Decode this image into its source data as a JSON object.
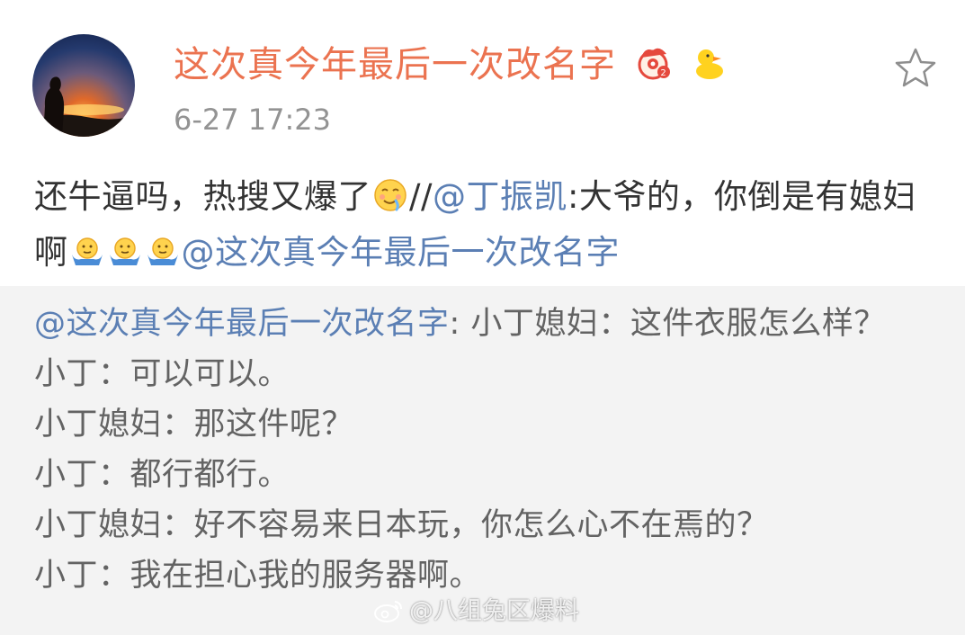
{
  "post": {
    "username": "这次真今年最后一次改名字",
    "timestamp": "6-27 17:23",
    "badges": [
      "vip-badge-icon",
      "duck-icon"
    ],
    "text_part1": "还牛逼吗，热搜又爆了",
    "separator": "//",
    "mention1": "@丁振凯",
    "text_part2": ":大爷的，你倒是有媳妇啊",
    "mention2": "@这次真今年最后一次改名字"
  },
  "repost": {
    "mention": "@这次真今年最后一次改名字",
    "first_text": ": 小丁媳妇：这件衣服怎么样？",
    "lines": [
      "小丁：可以可以。",
      "小丁媳妇：那这件呢？",
      "小丁：都行都行。",
      "小丁媳妇：好不容易来日本玩，你怎么心不在焉的？",
      "小丁：我在担心我的服务器啊。"
    ]
  },
  "watermark": {
    "text": "@八组兔区爆料"
  },
  "colors": {
    "username": "#eb7350",
    "mention": "#5b7fb4",
    "timestamp": "#939393",
    "repost_bg": "#f3f3f3"
  }
}
